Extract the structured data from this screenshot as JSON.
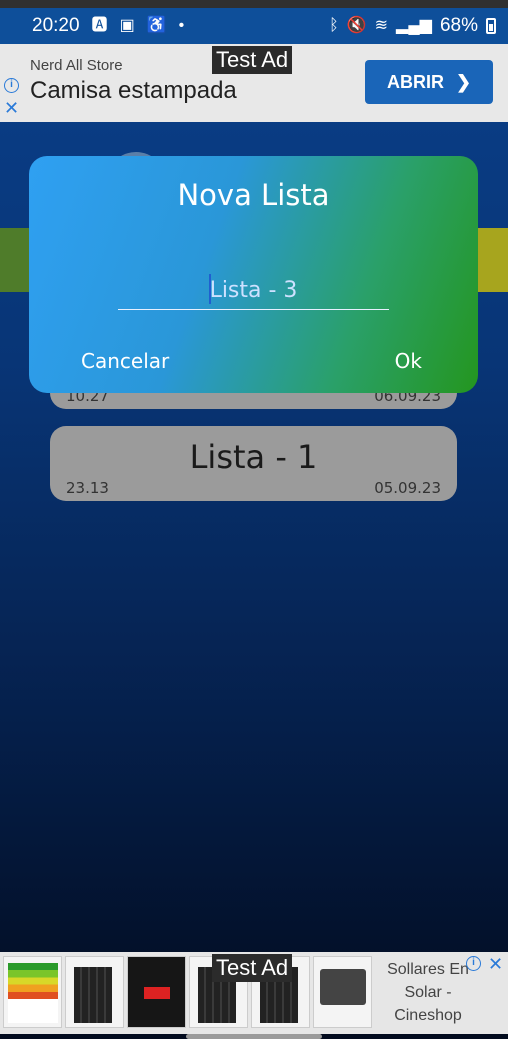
{
  "status_bar": {
    "time": "20:20",
    "battery": "68%",
    "icons_left": [
      "notification-a-icon",
      "sim-icon",
      "accessibility-icon",
      "dot-icon"
    ],
    "icons_right": [
      "bluetooth-icon",
      "mute-icon",
      "wifi-icon",
      "signal-icon",
      "battery-icon"
    ]
  },
  "ad_top": {
    "test_label": "Test Ad",
    "store": "Nerd All Store",
    "title": "Camisa estampada",
    "button": "ABRIR",
    "button_icon": "chevron-right-icon"
  },
  "background": {
    "cards": [
      {
        "title": "",
        "value": "10.27",
        "date": "06.09.23"
      },
      {
        "title": "Lista - 1",
        "value": "23.13",
        "date": "05.09.23"
      }
    ]
  },
  "dialog": {
    "title": "Nova Lista",
    "input_placeholder": "Lista - 3",
    "input_value": "",
    "cancel": "Cancelar",
    "ok": "Ok",
    "colors": {
      "start": "#2fa0f2",
      "end": "#24961f"
    }
  },
  "ad_bottom": {
    "test_label": "Test Ad",
    "text": "Sollares En Solar - Cineshop",
    "images": [
      "energy-label",
      "solar-panel",
      "inverter-box",
      "solar-panel",
      "solar-panel",
      "inverter-unit"
    ]
  }
}
